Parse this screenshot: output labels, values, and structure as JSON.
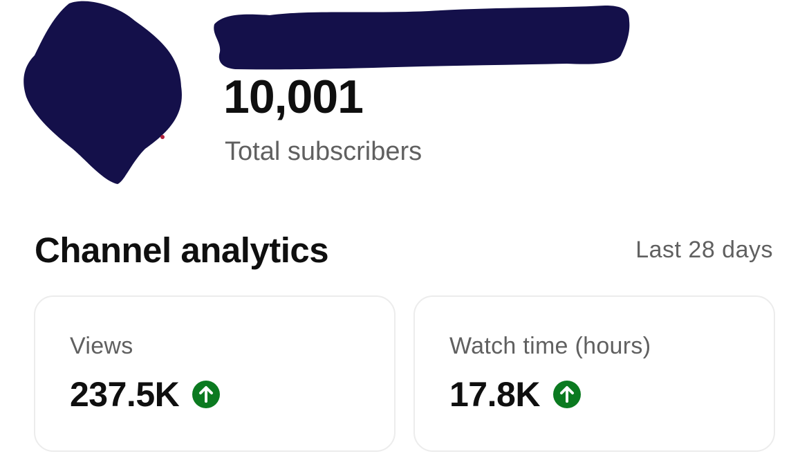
{
  "channel": {
    "subscriber_count": "10,001",
    "subscriber_label": "Total subscribers"
  },
  "analytics": {
    "title": "Channel analytics",
    "period": "Last 28 days",
    "metrics": [
      {
        "label": "Views",
        "value": "237.5K",
        "trend_icon": "arrow-up-circle-icon",
        "trend": "up"
      },
      {
        "label": "Watch time (hours)",
        "value": "17.8K",
        "trend_icon": "arrow-up-circle-icon",
        "trend": "up"
      }
    ]
  },
  "colors": {
    "trend_up": "#0b7a20",
    "redaction": "#14104a",
    "primary_text": "#0f0f0f",
    "secondary_text": "#606060",
    "card_border": "#ececec"
  }
}
